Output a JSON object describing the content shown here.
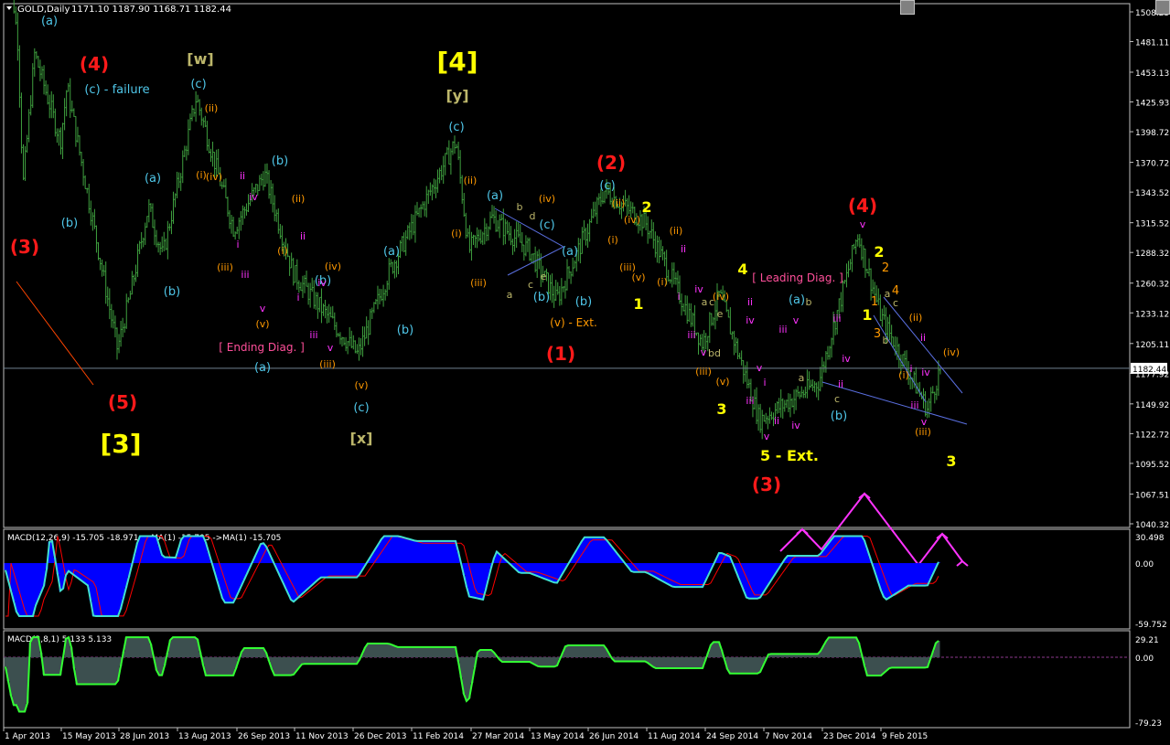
{
  "window": {
    "symbol_title": "GOLD,Daily",
    "ohlc": "1171.10 1187.90 1168.71 1182.44",
    "current_price": "1182.44"
  },
  "colors": {
    "background": "#000000",
    "grid_border": "#c0c0c0",
    "candles": "#3fa03f",
    "price_line": "#708090",
    "macd_hist": "#0000ff",
    "macd_signal": "#ff0000",
    "macd_line": "#40e0d0",
    "macd2_line": "#33ff33",
    "macd2_hist": "#3c4f4f",
    "wedge": "#5a6fe0",
    "arrow": "#ff33ff",
    "cyan": "#4fc6e8",
    "red": "#ff1a1a",
    "yellow": "#ffff00",
    "orange": "#ff9900",
    "magenta": "#ff33ff",
    "khaki": "#bdb76b",
    "pink": "#ff4f9a"
  },
  "price_axis_labels": [
    "1508.25",
    "1481.11",
    "1453.13",
    "1425.93",
    "1398.72",
    "1370.72",
    "1343.52",
    "1315.52",
    "1288.32",
    "1260.32",
    "1233.12",
    "1205.11",
    "1177.92",
    "1149.92",
    "1122.72",
    "1095.52",
    "1067.51",
    "1040.32"
  ],
  "macd_panel": {
    "label": "MACD(12,26,9) -15.705 -18.971 ->MA(1) -15.705 ->MA(1) -15.705",
    "axis_labels": [
      "30.498",
      "0.00",
      "-59.752"
    ]
  },
  "macd2_panel": {
    "label": "MACD(3,8,1) 5.133 5.133",
    "axis_labels": [
      "29.21",
      "0.00",
      "-79.23"
    ]
  },
  "time_axis_labels": [
    "1 Apr 2013",
    "15 May 2013",
    "28 Jun 2013",
    "13 Aug 2013",
    "26 Sep 2013",
    "11 Nov 2013",
    "26 Dec 2013",
    "11 Feb 2014",
    "27 Mar 2014",
    "13 May 2014",
    "26 Jun 2014",
    "11 Aug 2014",
    "24 Sep 2014",
    "7 Nov 2014",
    "23 Dec 2014",
    "9 Feb 2015"
  ],
  "annotations": [
    {
      "text": "(a)",
      "color": "cyan",
      "size": 13
    },
    {
      "text": "(4)",
      "color": "red",
      "size": 20
    },
    {
      "text": "(c) - failure",
      "color": "cyan",
      "size": 13
    },
    {
      "text": "[w]",
      "color": "khaki",
      "size": 16
    },
    {
      "text": "(c)",
      "color": "cyan",
      "size": 13
    },
    {
      "text": "(ii)",
      "color": "orange",
      "size": 11
    },
    {
      "text": "(iv)",
      "color": "orange",
      "size": 11
    },
    {
      "text": "(i)",
      "color": "orange",
      "size": 11
    },
    {
      "text": "ii",
      "color": "magenta",
      "size": 11
    },
    {
      "text": "iv",
      "color": "magenta",
      "size": 11
    },
    {
      "text": "i",
      "color": "magenta",
      "size": 11
    },
    {
      "text": "iii",
      "color": "magenta",
      "size": 11
    },
    {
      "text": "v",
      "color": "magenta",
      "size": 11
    },
    {
      "text": "(iii)",
      "color": "orange",
      "size": 11
    },
    {
      "text": "(v)",
      "color": "orange",
      "size": 11
    },
    {
      "text": "(b)",
      "color": "cyan",
      "size": 13
    },
    {
      "text": "(a)",
      "color": "cyan",
      "size": 13
    },
    {
      "text": "(b)",
      "color": "cyan",
      "size": 13
    },
    {
      "text": "(3)",
      "color": "red",
      "size": 20
    },
    {
      "text": "(b)",
      "color": "cyan",
      "size": 13
    },
    {
      "text": "(b)",
      "color": "cyan",
      "size": 13
    },
    {
      "text": "(i)",
      "color": "orange",
      "size": 11
    },
    {
      "text": "(ii)",
      "color": "orange",
      "size": 11
    },
    {
      "text": "ii",
      "color": "magenta",
      "size": 11
    },
    {
      "text": "i",
      "color": "magenta",
      "size": 11
    },
    {
      "text": "iv",
      "color": "magenta",
      "size": 11
    },
    {
      "text": "(iv)",
      "color": "orange",
      "size": 11
    },
    {
      "text": "iii",
      "color": "magenta",
      "size": 11
    },
    {
      "text": "v",
      "color": "magenta",
      "size": 11
    },
    {
      "text": "(iii)",
      "color": "orange",
      "size": 11
    },
    {
      "text": "[ Ending Diag. ]",
      "color": "pink",
      "size": 12
    },
    {
      "text": "(a)",
      "color": "cyan",
      "size": 13
    },
    {
      "text": "(5)",
      "color": "red",
      "size": 20
    },
    {
      "text": "[3]",
      "color": "yellow",
      "size": 28
    },
    {
      "text": "(v)",
      "color": "orange",
      "size": 11
    },
    {
      "text": "(c)",
      "color": "cyan",
      "size": 13
    },
    {
      "text": "[x]",
      "color": "khaki",
      "size": 16
    },
    {
      "text": "(a)",
      "color": "cyan",
      "size": 13
    },
    {
      "text": "(b)",
      "color": "cyan",
      "size": 13
    },
    {
      "text": "[4]",
      "color": "yellow",
      "size": 28
    },
    {
      "text": "[y]",
      "color": "khaki",
      "size": 16
    },
    {
      "text": "(c)",
      "color": "cyan",
      "size": 13
    },
    {
      "text": "(ii)",
      "color": "orange",
      "size": 11
    },
    {
      "text": "(i)",
      "color": "orange",
      "size": 11
    },
    {
      "text": "(iii)",
      "color": "orange",
      "size": 11
    },
    {
      "text": "(a)",
      "color": "cyan",
      "size": 13
    },
    {
      "text": "b",
      "color": "khaki",
      "size": 11
    },
    {
      "text": "d",
      "color": "khaki",
      "size": 11
    },
    {
      "text": "(iv)",
      "color": "orange",
      "size": 11
    },
    {
      "text": "(c)",
      "color": "cyan",
      "size": 13
    },
    {
      "text": "(a)",
      "color": "cyan",
      "size": 13
    },
    {
      "text": "a",
      "color": "khaki",
      "size": 11
    },
    {
      "text": "c",
      "color": "khaki",
      "size": 11
    },
    {
      "text": "e",
      "color": "khaki",
      "size": 11
    },
    {
      "text": "(b)",
      "color": "cyan",
      "size": 13
    },
    {
      "text": "(b)",
      "color": "cyan",
      "size": 13
    },
    {
      "text": "(v) - Ext.",
      "color": "orange",
      "size": 12
    },
    {
      "text": "(1)",
      "color": "red",
      "size": 20
    },
    {
      "text": "(2)",
      "color": "red",
      "size": 20
    },
    {
      "text": "(c)",
      "color": "cyan",
      "size": 13
    },
    {
      "text": "(ii)",
      "color": "orange",
      "size": 11
    },
    {
      "text": "2",
      "color": "yellow",
      "size": 16
    },
    {
      "text": "(iv)",
      "color": "orange",
      "size": 11
    },
    {
      "text": "(i)",
      "color": "orange",
      "size": 11
    },
    {
      "text": "(iii)",
      "color": "orange",
      "size": 11
    },
    {
      "text": "(v)",
      "color": "orange",
      "size": 11
    },
    {
      "text": "1",
      "color": "yellow",
      "size": 16
    },
    {
      "text": "(i)",
      "color": "orange",
      "size": 11
    },
    {
      "text": "(ii)",
      "color": "orange",
      "size": 11
    },
    {
      "text": "ii",
      "color": "magenta",
      "size": 11
    },
    {
      "text": "(iv)",
      "color": "orange",
      "size": 11
    },
    {
      "text": "i",
      "color": "magenta",
      "size": 11
    },
    {
      "text": "iv",
      "color": "magenta",
      "size": 11
    },
    {
      "text": "a",
      "color": "khaki",
      "size": 11
    },
    {
      "text": "c",
      "color": "khaki",
      "size": 11
    },
    {
      "text": "e",
      "color": "khaki",
      "size": 11
    },
    {
      "text": "iii",
      "color": "magenta",
      "size": 11
    },
    {
      "text": "v",
      "color": "magenta",
      "size": 11
    },
    {
      "text": "bd",
      "color": "khaki",
      "size": 11
    },
    {
      "text": "(iii)",
      "color": "orange",
      "size": 11
    },
    {
      "text": "(v)",
      "color": "orange",
      "size": 11
    },
    {
      "text": "3",
      "color": "yellow",
      "size": 16
    },
    {
      "text": "4",
      "color": "yellow",
      "size": 16
    },
    {
      "text": "[ Leading Diag. ]",
      "color": "pink",
      "size": 12
    },
    {
      "text": "ii",
      "color": "magenta",
      "size": 11
    },
    {
      "text": "iv",
      "color": "magenta",
      "size": 11
    },
    {
      "text": "v",
      "color": "magenta",
      "size": 11
    },
    {
      "text": "i",
      "color": "magenta",
      "size": 11
    },
    {
      "text": "iii",
      "color": "magenta",
      "size": 11
    },
    {
      "text": "ii",
      "color": "magenta",
      "size": 11
    },
    {
      "text": "v",
      "color": "magenta",
      "size": 11
    },
    {
      "text": "5 - Ext.",
      "color": "yellow",
      "size": 16
    },
    {
      "text": "(3)",
      "color": "red",
      "size": 20
    },
    {
      "text": "(a)",
      "color": "cyan",
      "size": 13
    },
    {
      "text": "b",
      "color": "khaki",
      "size": 11
    },
    {
      "text": "iii",
      "color": "magenta",
      "size": 11
    },
    {
      "text": "v",
      "color": "magenta",
      "size": 11
    },
    {
      "text": "a",
      "color": "khaki",
      "size": 11
    },
    {
      "text": "iv",
      "color": "magenta",
      "size": 11
    },
    {
      "text": "c",
      "color": "khaki",
      "size": 11
    },
    {
      "text": "ii",
      "color": "magenta",
      "size": 11
    },
    {
      "text": "(b)",
      "color": "cyan",
      "size": 13
    },
    {
      "text": "iii",
      "color": "magenta",
      "size": 11
    },
    {
      "text": "iv",
      "color": "magenta",
      "size": 11
    },
    {
      "text": "(4)",
      "color": "red",
      "size": 20
    },
    {
      "text": "v",
      "color": "magenta",
      "size": 11
    },
    {
      "text": "2",
      "color": "yellow",
      "size": 16
    },
    {
      "text": "2",
      "color": "orange",
      "size": 13
    },
    {
      "text": "1",
      "color": "yellow",
      "size": 16
    },
    {
      "text": "1",
      "color": "orange",
      "size": 13
    },
    {
      "text": "3",
      "color": "orange",
      "size": 13
    },
    {
      "text": "4",
      "color": "orange",
      "size": 13
    },
    {
      "text": "a",
      "color": "khaki",
      "size": 11
    },
    {
      "text": "c",
      "color": "khaki",
      "size": 11
    },
    {
      "text": "b",
      "color": "khaki",
      "size": 11
    },
    {
      "text": "(ii)",
      "color": "orange",
      "size": 11
    },
    {
      "text": "ii",
      "color": "magenta",
      "size": 11
    },
    {
      "text": "(i)",
      "color": "orange",
      "size": 11
    },
    {
      "text": "i",
      "color": "magenta",
      "size": 11
    },
    {
      "text": "iv",
      "color": "magenta",
      "size": 11
    },
    {
      "text": "iii",
      "color": "magenta",
      "size": 11
    },
    {
      "text": "v",
      "color": "magenta",
      "size": 11
    },
    {
      "text": "(iii)",
      "color": "orange",
      "size": 11
    },
    {
      "text": "(iv)",
      "color": "orange",
      "size": 11
    },
    {
      "text": "3",
      "color": "yellow",
      "size": 16
    }
  ],
  "chart_data": {
    "type": "candlestick",
    "title": "GOLD,Daily",
    "x": [
      "1 Apr 2013",
      "15 May 2013",
      "28 Jun 2013",
      "13 Aug 2013",
      "26 Sep 2013",
      "11 Nov 2013",
      "26 Dec 2013",
      "11 Feb 2014",
      "27 Mar 2014",
      "13 May 2014",
      "26 Jun 2014",
      "11 Aug 2014",
      "24 Sep 2014",
      "7 Nov 2014",
      "23 Dec 2014",
      "9 Feb 2015"
    ],
    "close_path": [
      {
        "date": "1 Apr 2013",
        "close": 1600
      },
      {
        "date": "12 Apr 2013",
        "close": 1480
      },
      {
        "date": "16 Apr 2013",
        "close": 1350
      },
      {
        "date": "25 Apr 2013",
        "close": 1470
      },
      {
        "date": "15 May 2013",
        "close": 1390
      },
      {
        "date": "20 May 2013",
        "close": 1440
      },
      {
        "date": "28 Jun 2013",
        "close": 1200
      },
      {
        "date": "8 Jul 2013",
        "close": 1250
      },
      {
        "date": "22 Jul 2013",
        "close": 1330
      },
      {
        "date": "2 Aug 2013",
        "close": 1285
      },
      {
        "date": "28 Aug 2013",
        "close": 1430
      },
      {
        "date": "26 Sep 2013",
        "close": 1310
      },
      {
        "date": "20 Oct 2013",
        "close": 1360
      },
      {
        "date": "11 Nov 2013",
        "close": 1270
      },
      {
        "date": "31 Dec 2013",
        "close": 1195
      },
      {
        "date": "24 Jan 2014",
        "close": 1270
      },
      {
        "date": "17 Mar 2014",
        "close": 1390
      },
      {
        "date": "27 Mar 2014",
        "close": 1290
      },
      {
        "date": "14 Apr 2014",
        "close": 1320
      },
      {
        "date": "13 May 2014",
        "close": 1290
      },
      {
        "date": "3 Jun 2014",
        "close": 1245
      },
      {
        "date": "10 Jul 2014",
        "close": 1345
      },
      {
        "date": "11 Aug 2014",
        "close": 1315
      },
      {
        "date": "24 Sep 2014",
        "close": 1205
      },
      {
        "date": "7 Oct 2014",
        "close": 1250
      },
      {
        "date": "7 Nov 2014",
        "close": 1135
      },
      {
        "date": "23 Dec 2014",
        "close": 1170
      },
      {
        "date": "22 Jan 2015",
        "close": 1305
      },
      {
        "date": "9 Feb 2015",
        "close": 1230
      },
      {
        "date": "17 Mar 2015",
        "close": 1145
      },
      {
        "date": "27 Mar 2015",
        "close": 1182.44
      }
    ],
    "ylabel": "",
    "ylim": [
      1030,
      1520
    ],
    "grid": false,
    "series": [
      {
        "name": "MACD(12,26,9)",
        "last": -15.705,
        "signal": -18.971
      },
      {
        "name": "MACD(3,8,1)",
        "last": 5.133
      }
    ]
  }
}
